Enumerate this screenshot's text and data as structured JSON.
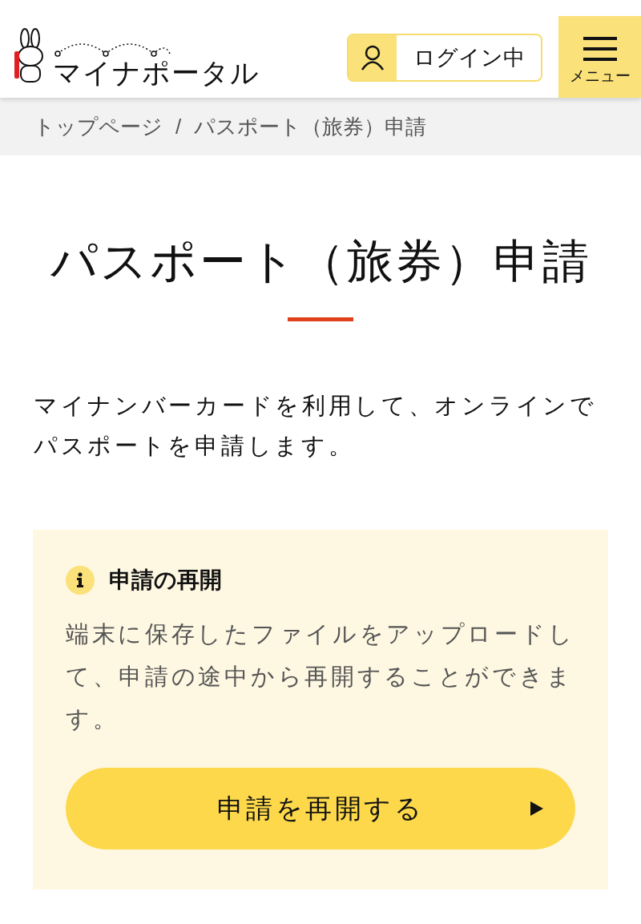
{
  "header": {
    "logo_text": "マイナポータル",
    "login_button": "ログイン中",
    "menu_button": "メニュー"
  },
  "breadcrumb": {
    "link": "トップページ",
    "separator": "/",
    "current": "パスポート（旅券）申請"
  },
  "page": {
    "title": "パスポート（旅券）申請",
    "description": "マイナンバーカードを利用して、オンラインでパスポートを申請します。"
  },
  "notice": {
    "heading": "申請の再開",
    "body": "端末に保存したファイルをアップロードして、申請の途中から再開することができます。",
    "button": "申請を再開する"
  }
}
